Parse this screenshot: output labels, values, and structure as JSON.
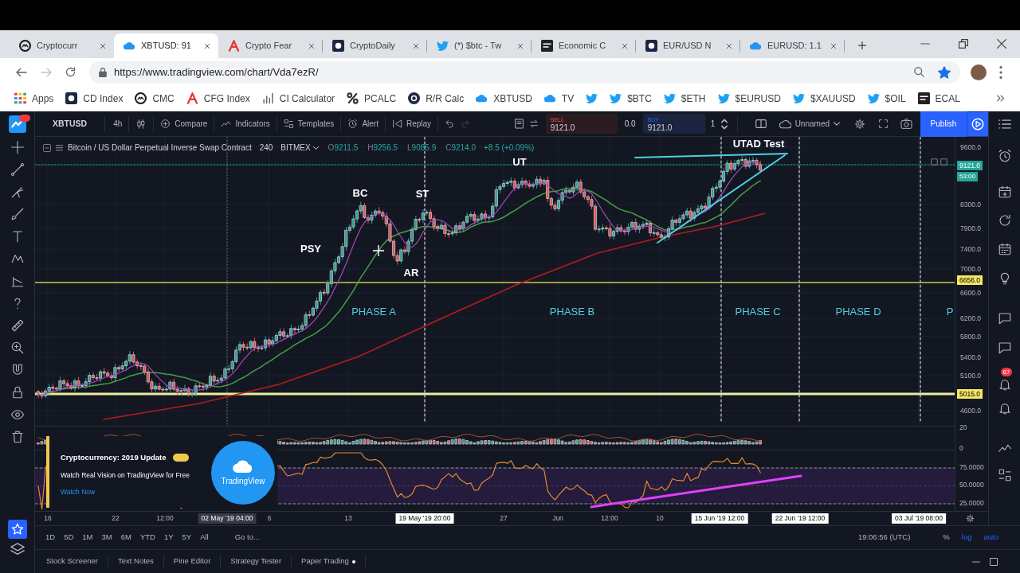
{
  "browser": {
    "tabs": [
      {
        "title": "Cryptocurr",
        "selected": false
      },
      {
        "title": "XBTUSD: 91",
        "selected": true
      },
      {
        "title": "Crypto Fear",
        "selected": false
      },
      {
        "title": "CryptoDaily",
        "selected": false
      },
      {
        "title": "(*) $btc - Tw",
        "selected": false
      },
      {
        "title": "Economic C",
        "selected": false
      },
      {
        "title": "EUR/USD N",
        "selected": false
      },
      {
        "title": "EURUSD: 1.1",
        "selected": false
      }
    ],
    "url": "https://www.tradingview.com/chart/Vda7ezR/",
    "bookmarked": true,
    "bookmarks": [
      {
        "kind": "text",
        "label": "Apps"
      },
      {
        "kind": "text",
        "label": "CD Index"
      },
      {
        "kind": "text",
        "label": "CMC"
      },
      {
        "kind": "text",
        "label": "CFG Index"
      },
      {
        "kind": "text",
        "label": "CI Calculator"
      },
      {
        "kind": "text",
        "label": "PCALC"
      },
      {
        "kind": "text",
        "label": "R/R Calc"
      },
      {
        "kind": "text",
        "label": "XBTUSD"
      },
      {
        "kind": "text",
        "label": "TV"
      },
      {
        "kind": "icon"
      },
      {
        "kind": "text",
        "label": "$BTC"
      },
      {
        "kind": "text",
        "label": "$ETH"
      },
      {
        "kind": "text",
        "label": "$EURUSD"
      },
      {
        "kind": "text",
        "label": "$XAUUSD"
      },
      {
        "kind": "text",
        "label": "$OIL"
      },
      {
        "kind": "text",
        "label": "ECAL"
      }
    ]
  },
  "tradingview": {
    "favorites_selected": true,
    "notification_count": "67",
    "toolbar": {
      "symbol": "XBTUSD",
      "interval": "4h",
      "actions": [
        "Compare",
        "Indicators",
        "Templates",
        "Alert",
        "Replay"
      ],
      "sell": {
        "label": "SELL",
        "price": "9121.0"
      },
      "spread": "0.0",
      "buy": {
        "label": "BUY",
        "price": "9121.0"
      },
      "quantity": "1",
      "layout": "Unnamed",
      "publish": "Publish"
    },
    "legend": {
      "title": "Bitcoin / US Dollar Perpetual Inverse Swap Contract",
      "interval": "240",
      "exchange": "BITMEX",
      "ohlc": [
        {
          "label": "O",
          "value": "9211.5"
        },
        {
          "label": "H",
          "value": "9256.5"
        },
        {
          "label": "L",
          "value": "9085.9"
        },
        {
          "label": "C",
          "value": "9214.0"
        }
      ],
      "change": "+8.5 (+0.09%)"
    },
    "annotations": [
      {
        "text": "UTAD Test",
        "kind": "event"
      },
      {
        "text": "UT",
        "kind": "event"
      },
      {
        "text": "BC",
        "kind": "event"
      },
      {
        "text": "ST",
        "kind": "event"
      },
      {
        "text": "PSY",
        "kind": "event"
      },
      {
        "text": "AR",
        "kind": "event"
      },
      {
        "text": "PHASE A",
        "kind": "phase"
      },
      {
        "text": "PHASE B",
        "kind": "phase"
      },
      {
        "text": "PHASE C",
        "kind": "phase"
      },
      {
        "text": "PHASE D",
        "kind": "phase"
      },
      {
        "text": "P",
        "kind": "phase"
      }
    ],
    "price_axis": {
      "labels": [
        "9600.0",
        "8300.0",
        "7900.0",
        "7400.0",
        "7000.0",
        "6600.0",
        "6200.0",
        "5800.0",
        "5400.0",
        "5100.0",
        "4600.0"
      ],
      "markers": [
        {
          "text": "9121.0",
          "kind": "last_price"
        },
        {
          "text": "53:00",
          "kind": "countdown"
        },
        {
          "text": "6656.0",
          "kind": "line"
        },
        {
          "text": "5015.0",
          "kind": "line"
        }
      ]
    },
    "indicator_axis": [
      "20",
      "0",
      "75.0000",
      "50.0000",
      "25.0000"
    ],
    "promo": {
      "title": "Cryptocurrency: 2019 Update",
      "text": "Watch Real Vision on TradingView for Free",
      "link": "Watch Now",
      "logo_text": "TradingView"
    },
    "time_axis": [
      {
        "text": "16",
        "kind": "tick"
      },
      {
        "text": "22",
        "kind": "tick"
      },
      {
        "text": "12:00",
        "kind": "tick"
      },
      {
        "text": "02 May '19 04:00",
        "kind": "cursor"
      },
      {
        "text": "6",
        "kind": "tick"
      },
      {
        "text": "13",
        "kind": "tick"
      },
      {
        "text": "19 May '19 20:00",
        "kind": "marker"
      },
      {
        "text": "27",
        "kind": "tick"
      },
      {
        "text": "Jun",
        "kind": "tick"
      },
      {
        "text": "12:00",
        "kind": "tick"
      },
      {
        "text": "10",
        "kind": "tick"
      },
      {
        "text": "15 Jun '19 12:00",
        "kind": "marker"
      },
      {
        "text": "22 Jun '19 12:00",
        "kind": "marker"
      },
      {
        "text": "03 Jul '19 08:00",
        "kind": "marker"
      }
    ],
    "ranges": [
      "1D",
      "5D",
      "1M",
      "3M",
      "6M",
      "YTD",
      "1Y",
      "5Y",
      "All"
    ],
    "goto": "Go to...",
    "clock": "19:06:56 (UTC)",
    "scale_modes": [
      {
        "label": "%",
        "on": false
      },
      {
        "label": "log",
        "on": true
      },
      {
        "label": "auto",
        "on": true
      }
    ],
    "bottom_tabs": [
      {
        "label": "Stock Screener",
        "dot": false
      },
      {
        "label": "Text Notes",
        "dot": false
      },
      {
        "label": "Pine Editor",
        "dot": false
      },
      {
        "label": "Strategy Tester",
        "dot": false
      },
      {
        "label": "Paper Trading",
        "dot": true
      }
    ]
  }
}
